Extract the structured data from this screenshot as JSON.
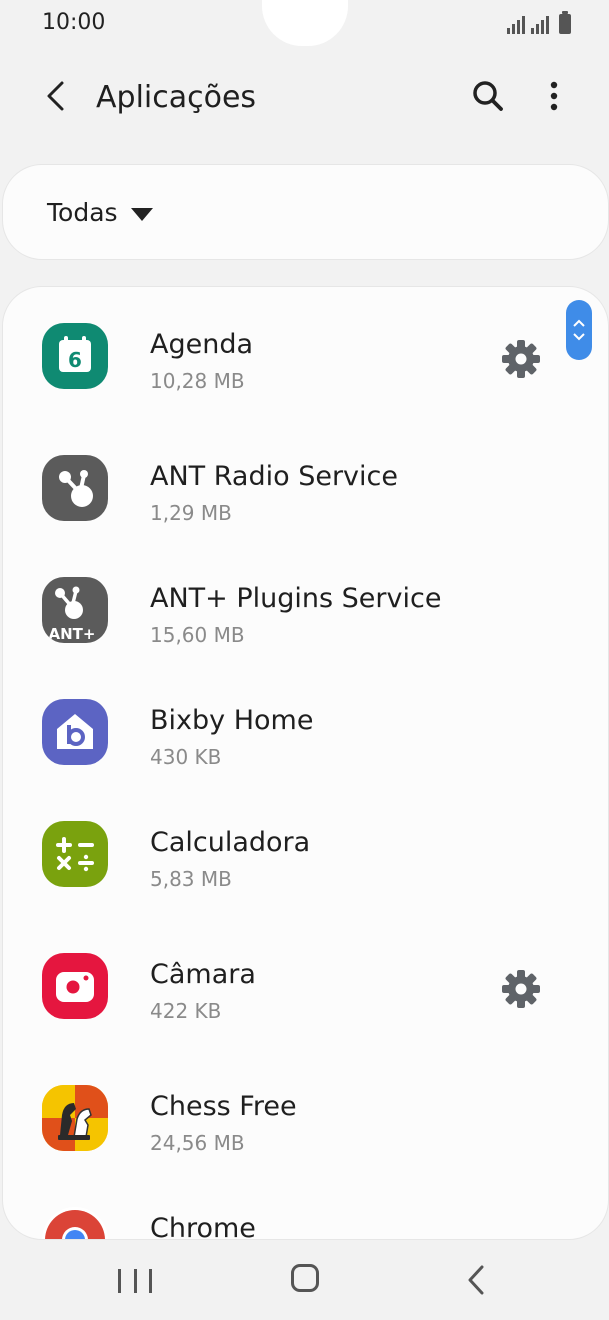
{
  "status_bar": {
    "time": "10:00"
  },
  "header": {
    "title": "Aplicações"
  },
  "filter": {
    "label": "Todas"
  },
  "apps": [
    {
      "name": "Agenda",
      "size": "10,28 MB",
      "icon": "calendar-icon",
      "color": "#0f8a72",
      "has_settings": true
    },
    {
      "name": "ANT Radio Service",
      "size": "1,29 MB",
      "icon": "ant-radio-icon",
      "color": "#5b5b5b",
      "has_settings": false
    },
    {
      "name": "ANT+ Plugins Service",
      "size": "15,60 MB",
      "icon": "ant-plugins-icon",
      "color": "#5b5b5b",
      "has_settings": false
    },
    {
      "name": "Bixby Home",
      "size": "430 KB",
      "icon": "bixby-icon",
      "color": "#5c64c3",
      "has_settings": false
    },
    {
      "name": "Calculadora",
      "size": "5,83 MB",
      "icon": "calculator-icon",
      "color": "#7aa20e",
      "has_settings": false
    },
    {
      "name": "Câmara",
      "size": "422 KB",
      "icon": "camera-icon",
      "color": "#e5163f",
      "has_settings": true
    },
    {
      "name": "Chess Free",
      "size": "24,56 MB",
      "icon": "chess-icon",
      "color": "#f0b400",
      "has_settings": false
    },
    {
      "name": "Chrome",
      "size": "",
      "icon": "chrome-icon",
      "color": "#dd4b39",
      "has_settings": false
    }
  ],
  "calendar_day": "6",
  "ant_plugins_badge": "ANT+",
  "colors": {
    "accent": "#3f8ce8",
    "background": "#f2f2f2",
    "card": "#fcfcfc"
  }
}
